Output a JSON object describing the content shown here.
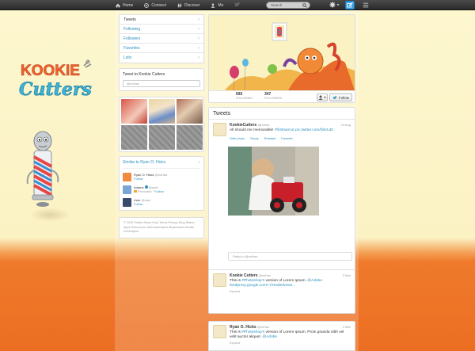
{
  "colors": {
    "accent": "#2a8fbd",
    "topbar": "#333333",
    "compose": "#3aa4e6",
    "orange": "#ec6e22",
    "cream": "#fbf2c4"
  },
  "topbar": {
    "nav": [
      {
        "label": "Home",
        "icon": "home-icon"
      },
      {
        "label": "Connect",
        "icon": "at-icon"
      },
      {
        "label": "Discover",
        "icon": "hash-icon"
      },
      {
        "label": "Me",
        "icon": "person-icon"
      }
    ],
    "search_placeholder": "Search",
    "icons": [
      "bird-icon",
      "search-icon",
      "gear-icon",
      "compose-icon",
      "menu-icon"
    ]
  },
  "brand": {
    "logo_text": "KOOKIE Cutters"
  },
  "sidebar": {
    "items": [
      {
        "label": "Tweets"
      },
      {
        "label": "Following"
      },
      {
        "label": "Followers"
      },
      {
        "label": "Favorites"
      },
      {
        "label": "Lists"
      }
    ],
    "tweet_to_title": "Tweet to Kookie Cutters",
    "tweet_to_value": "@noHas",
    "similar_title": "Similar to Ryan O. Hicks",
    "similar": [
      {
        "name": "Ryan O. Hicks",
        "handle": "@noHas",
        "action": "Follow",
        "note": ""
      },
      {
        "name": "Adams",
        "handle": "@owls",
        "action": "Follow",
        "note": "Promoted ·"
      },
      {
        "name": "User",
        "handle": "@user",
        "action": "Follow",
        "note": ""
      }
    ],
    "footer": "© 2013 Twitter About Help Terms Privacy Blog Status Apps Resources Jobs Advertisers Businesses Media Developers"
  },
  "profile": {
    "stats": [
      {
        "value": "692",
        "label": "FOLLOWING"
      },
      {
        "value": "347",
        "label": "FOLLOWERS"
      }
    ],
    "follow_label": "Follow"
  },
  "tweets": {
    "title": "Tweets",
    "items": [
      {
        "name": "KookieCutters",
        "handle": "@noHas",
        "date": "24 Aug",
        "text": "All should me memorable!",
        "hashtag": "#firsthaircut",
        "link": "pic.twitter.com/fdnrLd0",
        "actions": [
          "Hide photo",
          "Reply",
          "Retweet",
          "Favorite"
        ]
      }
    ],
    "reply_placeholder": "Reply to @noHas",
    "more": [
      {
        "name": "Kookie Cutters",
        "handle": "@noHas",
        "date": "2 Mar",
        "text_pre": "This is ",
        "hashtag": "#Photoshop's",
        "text_mid": " version of Lorem Ipsum. ",
        "mention": "@Adobe",
        "link": "feedproxy.google.com/~r/readerbewe...",
        "expand": "Expand"
      },
      {
        "name": "Ryan O. Hicks",
        "handle": "@noHas",
        "date": "2 Mar",
        "text_pre": "This is ",
        "hashtag": "#Photoshop's",
        "text_mid": " version of Lorem Ipsum. Proin gravida nibh vel velit auctor aliquet. ",
        "mention": "@Adobe",
        "link": "",
        "expand": "Expand"
      }
    ]
  }
}
